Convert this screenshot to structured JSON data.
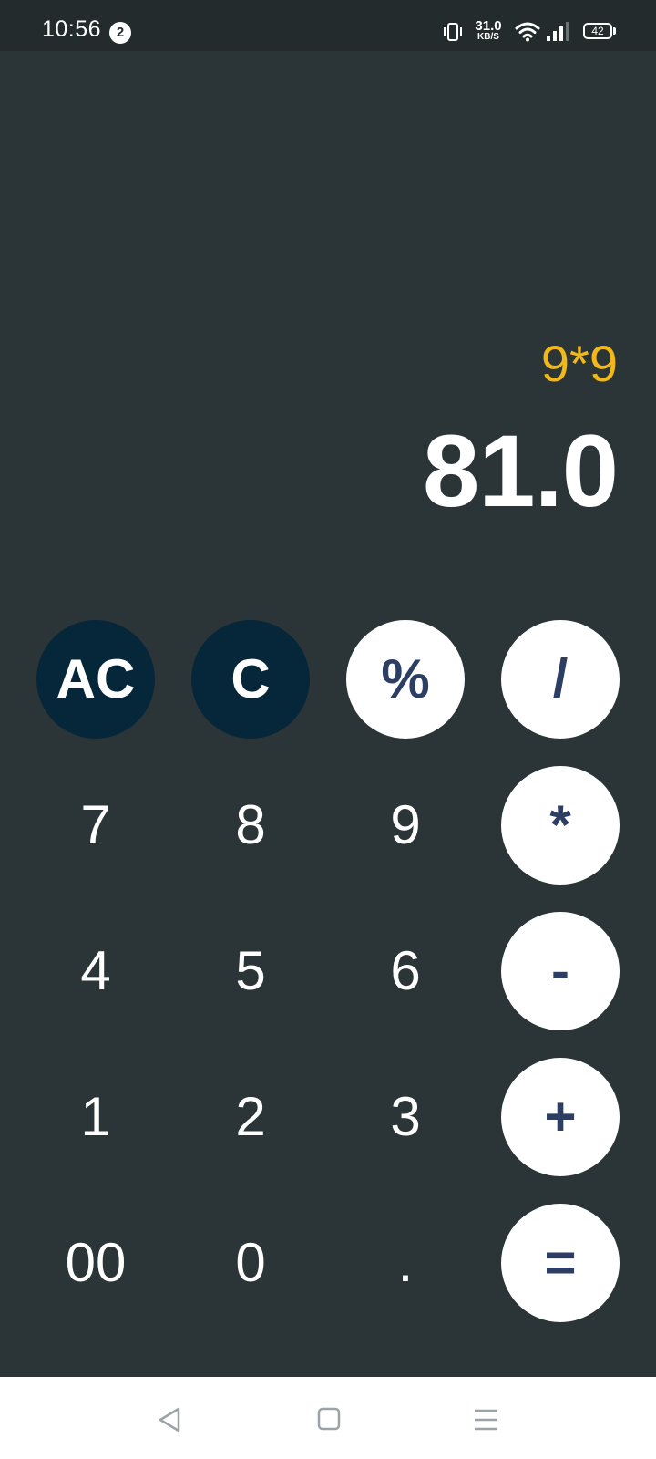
{
  "status_bar": {
    "time": "10:56",
    "notification_count": "2",
    "net_speed_value": "31.0",
    "net_speed_unit": "KB/S",
    "battery_level": "42"
  },
  "display": {
    "expression": "9*9",
    "result": "81.0",
    "expression_color": "#f2b81a"
  },
  "keypad": {
    "keys": [
      {
        "label": "AC",
        "style": "dark"
      },
      {
        "label": "C",
        "style": "dark"
      },
      {
        "label": "%",
        "style": "light"
      },
      {
        "label": "/",
        "style": "light"
      },
      {
        "label": "7",
        "style": "plain"
      },
      {
        "label": "8",
        "style": "plain"
      },
      {
        "label": "9",
        "style": "plain"
      },
      {
        "label": "*",
        "style": "light"
      },
      {
        "label": "4",
        "style": "plain"
      },
      {
        "label": "5",
        "style": "plain"
      },
      {
        "label": "6",
        "style": "plain"
      },
      {
        "label": "-",
        "style": "light"
      },
      {
        "label": "1",
        "style": "plain"
      },
      {
        "label": "2",
        "style": "plain"
      },
      {
        "label": "3",
        "style": "plain"
      },
      {
        "label": "+",
        "style": "light"
      },
      {
        "label": "00",
        "style": "plain"
      },
      {
        "label": "0",
        "style": "plain"
      },
      {
        "label": ".",
        "style": "plain"
      },
      {
        "label": "=",
        "style": "light"
      }
    ]
  },
  "colors": {
    "background": "#2b3537",
    "dark_key": "#062639",
    "light_key": "#ffffff",
    "operator_text": "#2c3e63"
  },
  "nav_bar": {
    "icons": [
      "back-icon",
      "home-icon",
      "menu-icon"
    ]
  }
}
